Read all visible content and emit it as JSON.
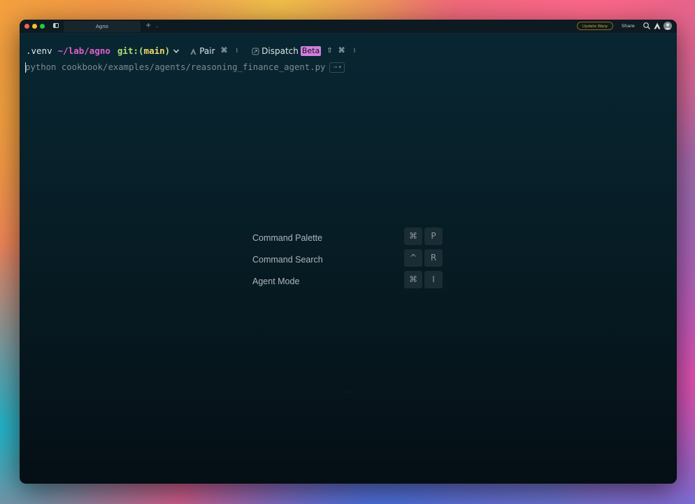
{
  "titlebar": {
    "tab_label": "Agno",
    "new_tab_glyph": "+",
    "new_tab_caret": "⌄",
    "update_label": "Update Warp",
    "share_label": "Share"
  },
  "prompt": {
    "venv": ".venv",
    "path": "~/lab/agno",
    "git_label": "git:",
    "branch_open": "(",
    "branch": "main",
    "branch_close": ")",
    "pair_label": "Pair",
    "pair_shortcut": "⌘",
    "pair_shortcut_key": "I",
    "dispatch_label": "Dispatch",
    "dispatch_badge": "Beta",
    "dispatch_shortcut_shift": "⇧",
    "dispatch_shortcut_cmd": "⌘",
    "dispatch_shortcut_key": "I"
  },
  "input": {
    "first_char": "p",
    "rest": "ython cookbook/examples/agents/reasoning_finance_agent.py",
    "accept_chip": "→ ▾"
  },
  "shortcuts": [
    {
      "label": "Command Palette",
      "keys": [
        "⌘",
        "P"
      ]
    },
    {
      "label": "Command Search",
      "keys": [
        "^",
        "R"
      ]
    },
    {
      "label": "Agent Mode",
      "keys": [
        "⌘",
        "I"
      ]
    }
  ],
  "colors": {
    "terminal_bg": "#071d26",
    "path": "#e060c8",
    "git": "#b6e070",
    "branch": "#f3d86a",
    "beta_badge": "#d27fe0",
    "update_border": "#8a6a14"
  },
  "icons": {
    "panel": "sidebar-icon",
    "search": "search-icon",
    "logo": "warp-logo-icon",
    "avatar": "avatar-icon",
    "pair": "pair-icon",
    "dispatch": "dispatch-icon",
    "chevron": "chevron-down-icon"
  }
}
